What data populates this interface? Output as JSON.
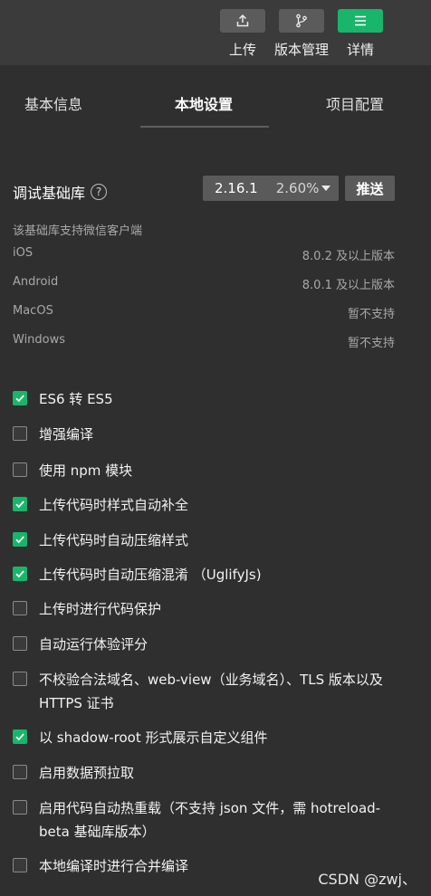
{
  "toolbar": {
    "upload_label": "上传",
    "version_label": "版本管理",
    "details_label": "详情",
    "accent_color": "#19b56b"
  },
  "tabs": [
    {
      "label": "基本信息",
      "active": false
    },
    {
      "label": "本地设置",
      "active": true
    },
    {
      "label": "项目配置",
      "active": false
    }
  ],
  "debug_lib": {
    "title": "调试基础库",
    "help_icon": "?",
    "version": "2.16.1",
    "percent": "2.60%",
    "push_label": "推送",
    "support_caption": "该基础库支持微信客户端",
    "platforms": [
      {
        "name": "iOS",
        "value": "8.0.2 及以上版本"
      },
      {
        "name": "Android",
        "value": "8.0.1 及以上版本"
      },
      {
        "name": "MacOS",
        "value": "暂不支持"
      },
      {
        "name": "Windows",
        "value": "暂不支持"
      }
    ]
  },
  "options": [
    {
      "label": "ES6 转 ES5",
      "checked": true
    },
    {
      "label": "增强编译",
      "checked": false
    },
    {
      "label": "使用 npm 模块",
      "checked": false
    },
    {
      "label": "上传代码时样式自动补全",
      "checked": true
    },
    {
      "label": "上传代码时自动压缩样式",
      "checked": true
    },
    {
      "label": "上传代码时自动压缩混淆 （UglifyJs)",
      "checked": true
    },
    {
      "label": "上传时进行代码保护",
      "checked": false
    },
    {
      "label": "自动运行体验评分",
      "checked": false
    },
    {
      "label": "不校验合法域名、web-view（业务域名）、TLS 版本以及 HTTPS 证书",
      "checked": false
    },
    {
      "label": "以 shadow-root 形式展示自定义组件",
      "checked": true
    },
    {
      "label": "启用数据预拉取",
      "checked": false
    },
    {
      "label": "启用代码自动热重载（不支持 json 文件，需 hotreload-beta 基础库版本）",
      "checked": false
    },
    {
      "label": "本地编译时进行合并编译",
      "checked": false
    }
  ],
  "watermark": "CSDN @zwj、"
}
